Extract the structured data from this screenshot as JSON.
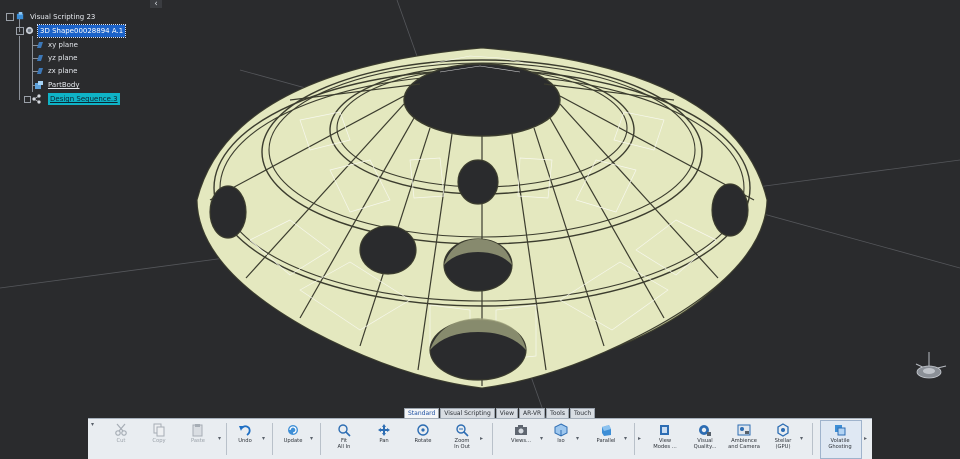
{
  "spec_tree": {
    "root": "Visual Scripting 23",
    "product": "3D Shape00028894 A.1",
    "planes": [
      "xy plane",
      "yz plane",
      "zx plane"
    ],
    "part_body": "PartBody",
    "design_sequence": "Design Sequence.3"
  },
  "tabs": [
    {
      "label": "Standard",
      "active": true
    },
    {
      "label": "Visual Scripting",
      "active": false
    },
    {
      "label": "View",
      "active": false
    },
    {
      "label": "AR-VR",
      "active": false
    },
    {
      "label": "Tools",
      "active": false
    },
    {
      "label": "Touch",
      "active": false
    }
  ],
  "toolbar": {
    "cut": "Cut",
    "copy": "Copy",
    "paste": "Paste",
    "undo": "Undo",
    "update": "Update",
    "fit_all_in_1": "Fit",
    "fit_all_in_2": "All In",
    "pan": "Pan",
    "rotate": "Rotate",
    "zoom_1": "Zoom",
    "zoom_2": "In Out",
    "views": "Views...",
    "iso": "Iso",
    "parallel": "Parallel",
    "view_modes_1": "View",
    "view_modes_2": "Modes ...",
    "visual_quality_1": "Visual",
    "visual_quality_2": "Quality...",
    "ambience_1": "Ambience",
    "ambience_2": "and Camera",
    "stellar_1": "Stellar",
    "stellar_2": "(GPU)",
    "volatile_1": "Volatile",
    "volatile_2": "Ghosting"
  },
  "colors": {
    "background": "#2a2b2d",
    "model_fill": "#e4e8bf",
    "model_edge": "#3b3c2e",
    "selection": "#1b62c8",
    "highlight": "#0fb3c6"
  }
}
